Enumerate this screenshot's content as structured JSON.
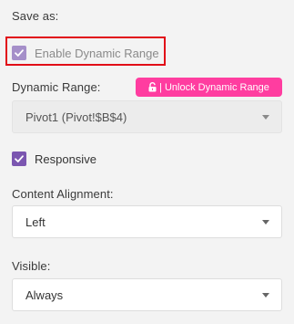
{
  "save_as": {
    "label": "Save as:"
  },
  "enable_dynamic_range": {
    "label": "Enable Dynamic Range",
    "checked": true
  },
  "dynamic_range": {
    "label": "Dynamic Range:",
    "unlock_button": "| Unlock Dynamic Range",
    "selected": "Pivot1 (Pivot!$B$4)"
  },
  "responsive": {
    "label": "Responsive",
    "checked": true
  },
  "content_alignment": {
    "label": "Content Alignment:",
    "selected": "Left"
  },
  "visible": {
    "label": "Visible:",
    "selected": "Always"
  },
  "colors": {
    "highlight": "#e10c17",
    "unlock_button": "#ff3da0",
    "checkbox_active": "#7b56b0",
    "checkbox_disabled": "#a58fc9"
  },
  "icons": {
    "checkbox": "check-icon",
    "unlock": "lock-icon",
    "dropdown": "chevron-down-icon"
  }
}
